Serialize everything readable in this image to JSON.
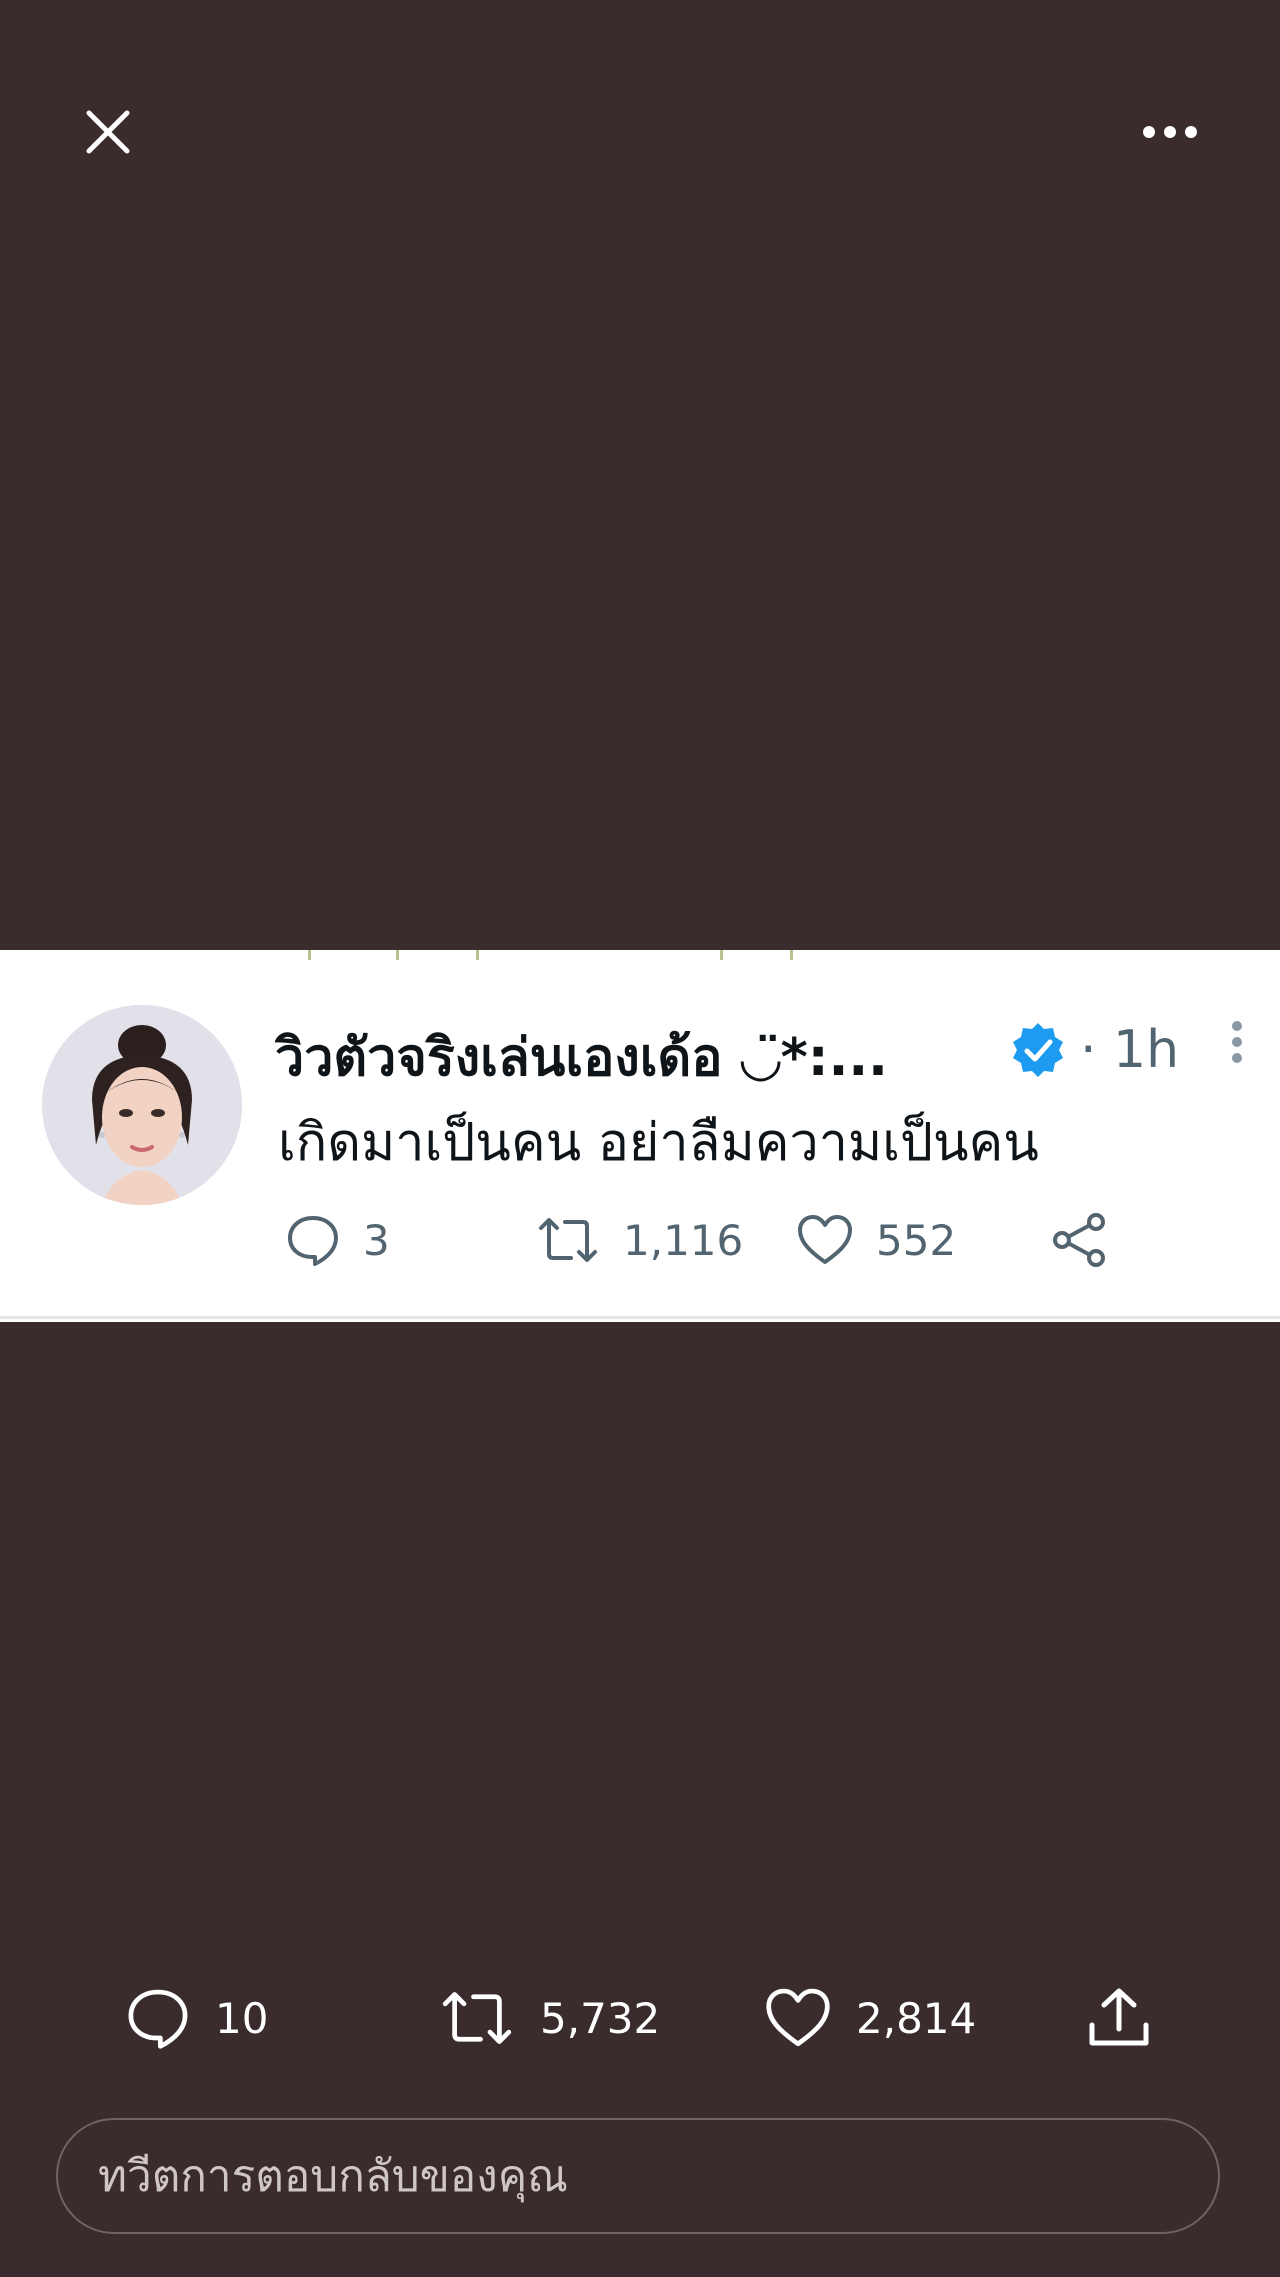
{
  "tweet": {
    "display_name": "วิวตัวจริงเล่นเองเด้อ ◡̈*:...",
    "time": "· 1h",
    "text": "เกิดมาเป็นคน อย่าลืมความเป็นคน",
    "replies": "3",
    "retweets": "1,116",
    "likes": "552"
  },
  "stats": {
    "replies": "10",
    "retweets": "5,732",
    "likes": "2,814"
  },
  "reply_placeholder": "ทวีตการตอบกลับของคุณ",
  "icons": [
    "close-icon",
    "more-icon",
    "verified-icon",
    "reply-icon",
    "retweet-icon",
    "like-icon",
    "share-icon"
  ],
  "colors": {
    "background": "#3a2c2d",
    "verified": "#1d9bf0",
    "secondary_text": "#536471"
  }
}
